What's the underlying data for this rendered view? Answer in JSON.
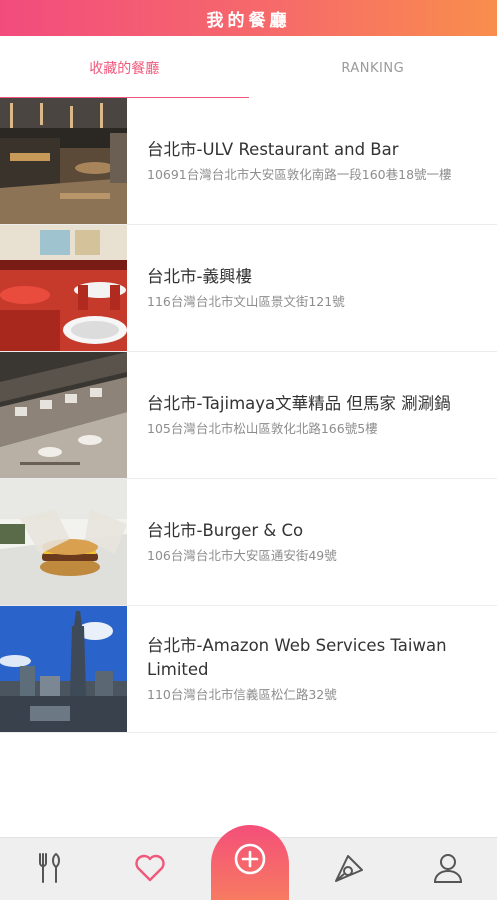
{
  "header": {
    "title": "我的餐廳"
  },
  "tabs": [
    {
      "label": "收藏的餐廳",
      "active": true
    },
    {
      "label": "RANKING",
      "active": false
    }
  ],
  "restaurants": [
    {
      "name": "台北市-ULV Restaurant and Bar",
      "address": "10691台灣台北市大安區敦化南路一段160巷18號一樓",
      "image": "restaurant-interior-photo"
    },
    {
      "name": "台北市-義興樓",
      "address": "116台灣台北市文山區景文街121號",
      "image": "dining-room-red-chairs-photo"
    },
    {
      "name": "台北市-Tajimaya文華精品 但馬家 涮涮鍋",
      "address": "105台灣台北市松山區敦化北路166號5樓",
      "image": "hotpot-counter-photo"
    },
    {
      "name": "台北市-Burger & Co",
      "address": "106台灣台北市大安區通安街49號",
      "image": "burger-preparation-photo"
    },
    {
      "name": "台北市-Amazon Web Services Taiwan Limited",
      "address": "110台灣台北市信義區松仁路32號",
      "image": "taipei-skyline-photo"
    }
  ],
  "bottom_nav": [
    {
      "icon": "fork-knife-icon",
      "active": false
    },
    {
      "icon": "heart-icon",
      "active": true
    },
    {
      "icon": "add-circle-icon",
      "active": false
    },
    {
      "icon": "pin-icon",
      "active": false
    },
    {
      "icon": "user-icon",
      "active": false
    }
  ],
  "colors": {
    "accent": "#f0587b",
    "gradient_start": "#f24c7d",
    "gradient_end": "#f98e4c",
    "inactive_icon": "#555555"
  }
}
